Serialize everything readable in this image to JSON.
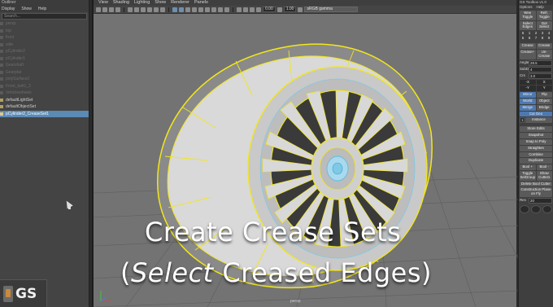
{
  "outliner": {
    "title": "Outliner",
    "menu": [
      "Display",
      "Show",
      "Help"
    ],
    "search_placeholder": "Search...",
    "items": [
      {
        "label": "persp",
        "state": "dim"
      },
      {
        "label": "top",
        "state": "dim"
      },
      {
        "label": "front",
        "state": "dim"
      },
      {
        "label": "side",
        "state": "dim"
      },
      {
        "label": "pCylinder2",
        "state": "dim"
      },
      {
        "label": "pCylinder1",
        "state": "dim"
      },
      {
        "label": "Gearshaft",
        "state": "dim"
      },
      {
        "label": "Gearplat",
        "state": "dim"
      },
      {
        "label": "polySurface2",
        "state": "dim"
      },
      {
        "label": "Front_belt1_2",
        "state": "dim"
      },
      {
        "label": "Vehiclewheels",
        "state": "dim"
      },
      {
        "label": "defaultLightSet",
        "state": "set"
      },
      {
        "label": "defaultObjectSet",
        "state": "set"
      },
      {
        "label": "pCylinder2_CreaseSet1",
        "state": "selected"
      }
    ]
  },
  "viewport": {
    "menu": [
      "View",
      "Shading",
      "Lighting",
      "Show",
      "Renderer",
      "Panels"
    ],
    "near_clip": "0.00",
    "exposure": "1.00",
    "color_space": "sRGB gamma",
    "camera": "persp"
  },
  "overlay": {
    "line1": "Create Crease Sets",
    "line2_open": "(",
    "line2_italic": "Select",
    "line2_rest": " Creased Edges)"
  },
  "logo": {
    "text": "GS"
  },
  "toolbox": {
    "title": "GS Toolbox v1.0",
    "menu": [
      "Options",
      "Help"
    ],
    "buttons_a": [
      "Wee Toggle",
      "Refr. Toggle"
    ],
    "buttons_b": [
      "Select Edges",
      "Dot Select"
    ],
    "numbers_1": [
      "6",
      "1",
      "2",
      "3",
      "4"
    ],
    "numbers_2": [
      "5",
      "6",
      "7",
      "8",
      "9"
    ],
    "buttons_c": [
      "Crease",
      "Crease"
    ],
    "buttons_d": [
      "Crease+",
      "Un-Crease"
    ],
    "angle_label": "Angle",
    "angle_value": "28.5",
    "subd_label": "SubD",
    "subd_value": "4",
    "crs_label": "Crs",
    "crs_value": "3.0",
    "axis_row1": [
      "-X",
      "X"
    ],
    "axis_row2": [
      "-Y",
      "Y"
    ],
    "mode_row1": [
      "Mirror",
      "Flip"
    ],
    "mode_row2": [
      "World",
      "Object"
    ],
    "mode_row3": [
      "Merge",
      "Bridge"
    ],
    "cut_label": "Cut Geo",
    "instance_count": "1",
    "instance_label": "Instance",
    "tool_buttons": [
      "Store Edits",
      "Snapshot",
      "Snap to Poly",
      "Straighten",
      "Combine",
      "Duplicate"
    ],
    "bool_buttons": [
      "Bool +",
      "Bool -"
    ],
    "toggle_buttons": [
      "Toggle SelGroup",
      "Show Cutters"
    ],
    "delete_bool": "Delete Bool Cutter",
    "construction": "Construction Plane on Fly",
    "res_label": "Res",
    "res_value": "20"
  }
}
